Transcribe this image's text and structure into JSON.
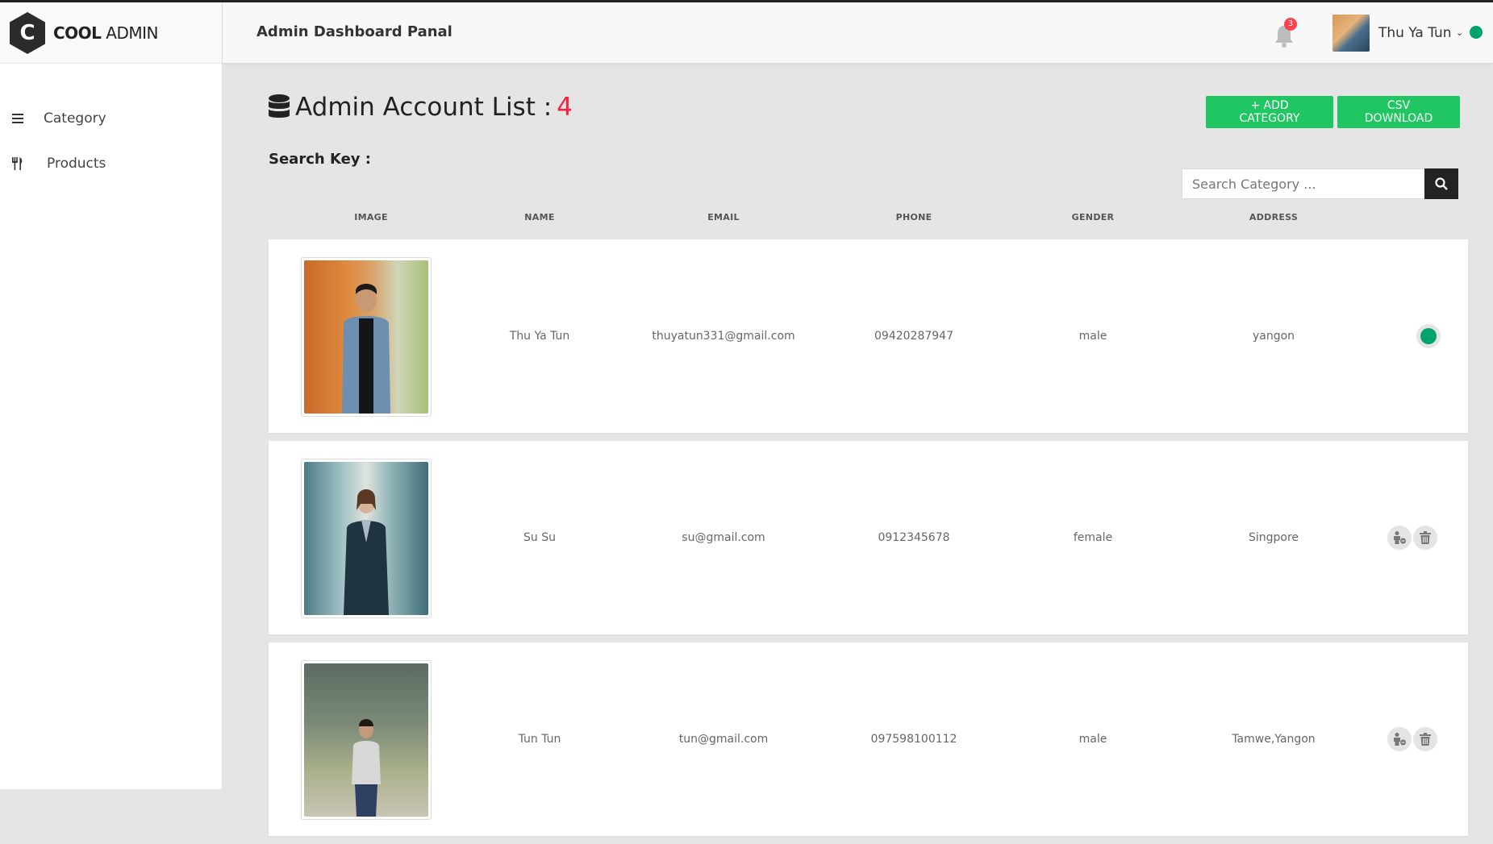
{
  "app": {
    "logo_bold": "COOL",
    "logo_light": " ADMIN",
    "logo_letter": "C"
  },
  "sidebar": {
    "items": [
      {
        "label": "Category",
        "icon": "menu-icon"
      },
      {
        "label": "Products",
        "icon": "cutlery-icon"
      }
    ]
  },
  "header": {
    "title": "Admin Dashboard Panal",
    "notification_count": "3",
    "user_name": "Thu Ya Tun",
    "status_color": "#00a36c"
  },
  "main": {
    "title": "Admin Account List :",
    "count": "4",
    "add_button": "+ ADD CATEGORY",
    "csv_button": "CSV DOWNLOAD",
    "search_key_label": "Search Key :",
    "search_placeholder": "Search Category ...",
    "columns": [
      "IMAGE",
      "NAME",
      "EMAIL",
      "PHONE",
      "GENDER",
      "ADDRESS"
    ],
    "rows": [
      {
        "name": "Thu Ya Tun",
        "email": "thuyatun331@gmail.com",
        "phone": "09420287947",
        "gender": "male",
        "address": "yangon",
        "is_current": true
      },
      {
        "name": "Su Su",
        "email": "su@gmail.com",
        "phone": "0912345678",
        "gender": "female",
        "address": "Singpore",
        "is_current": false
      },
      {
        "name": "Tun Tun",
        "email": "tun@gmail.com",
        "phone": "097598100112",
        "gender": "male",
        "address": "Tamwe,Yangon",
        "is_current": false
      }
    ]
  },
  "colors": {
    "accent_green": "#1fc661",
    "count_red": "#fa1e3c",
    "badge_red": "#fa4251"
  }
}
